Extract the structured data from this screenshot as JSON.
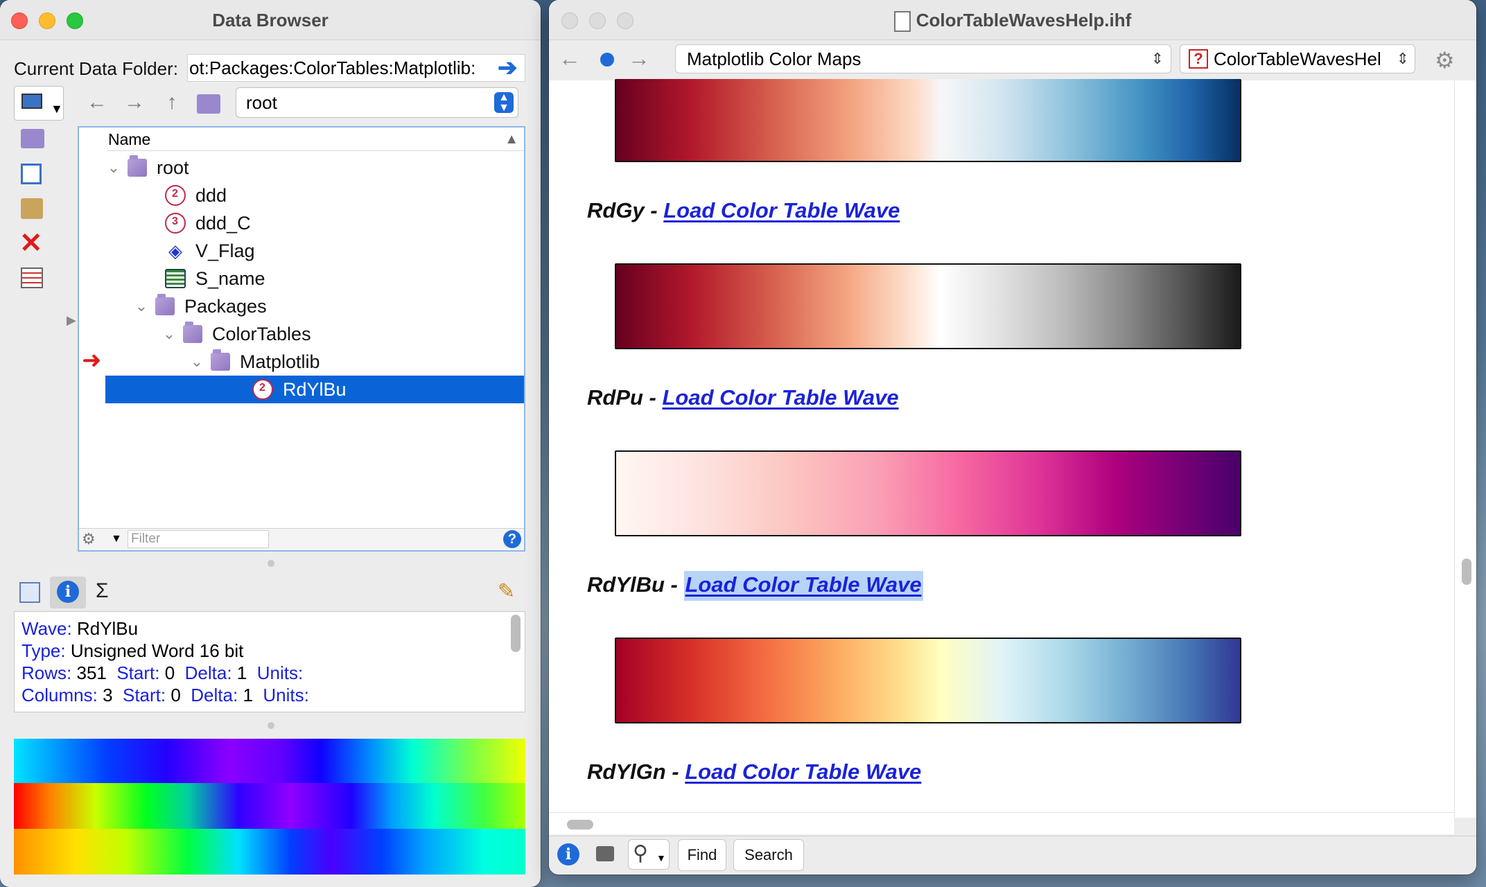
{
  "data_browser": {
    "title": "Data Browser",
    "current_folder_label": "Current Data Folder:",
    "current_folder_path": "ot:Packages:ColorTables:Matplotlib:",
    "folder_select": "root",
    "tree_header": "Name",
    "tree": [
      {
        "label": "root",
        "type": "folder"
      },
      {
        "label": "ddd",
        "type": "wave2"
      },
      {
        "label": "ddd_C",
        "type": "wave3"
      },
      {
        "label": "V_Flag",
        "type": "variable"
      },
      {
        "label": "S_name",
        "type": "string"
      },
      {
        "label": "Packages",
        "type": "folder"
      },
      {
        "label": "ColorTables",
        "type": "folder"
      },
      {
        "label": "Matplotlib",
        "type": "folder-current"
      },
      {
        "label": "RdYlBu",
        "type": "wave2",
        "selected": true
      }
    ],
    "filter_placeholder": "Filter",
    "info": {
      "wave_key": "Wave:",
      "wave_val": "RdYlBu",
      "type_key": "Type:",
      "type_val": "Unsigned Word 16 bit",
      "rows_key": "Rows:",
      "rows_val": "351",
      "start_key": "Start:",
      "start_val": "0",
      "delta_key": "Delta:",
      "delta_val": "1",
      "units_key": "Units:",
      "cols_key": "Columns:",
      "cols_val": "3",
      "start2_val": "0",
      "delta2_val": "1"
    },
    "sigma": "Σ"
  },
  "help": {
    "title": "ColorTableWavesHelp.ihf",
    "topic_select": "Matplotlib Color Maps",
    "file_select": "ColorTableWavesHel",
    "maps": [
      {
        "name": "RdGy -",
        "link": "Load Color Table Wave"
      },
      {
        "name": "RdPu -",
        "link": "Load Color Table Wave"
      },
      {
        "name": "RdYlBu -",
        "link": "Load Color Table Wave",
        "highlight": true
      },
      {
        "name": "RdYlGn -",
        "link": "Load Color Table Wave"
      }
    ],
    "find_label": "Find",
    "search_label": "Search"
  }
}
